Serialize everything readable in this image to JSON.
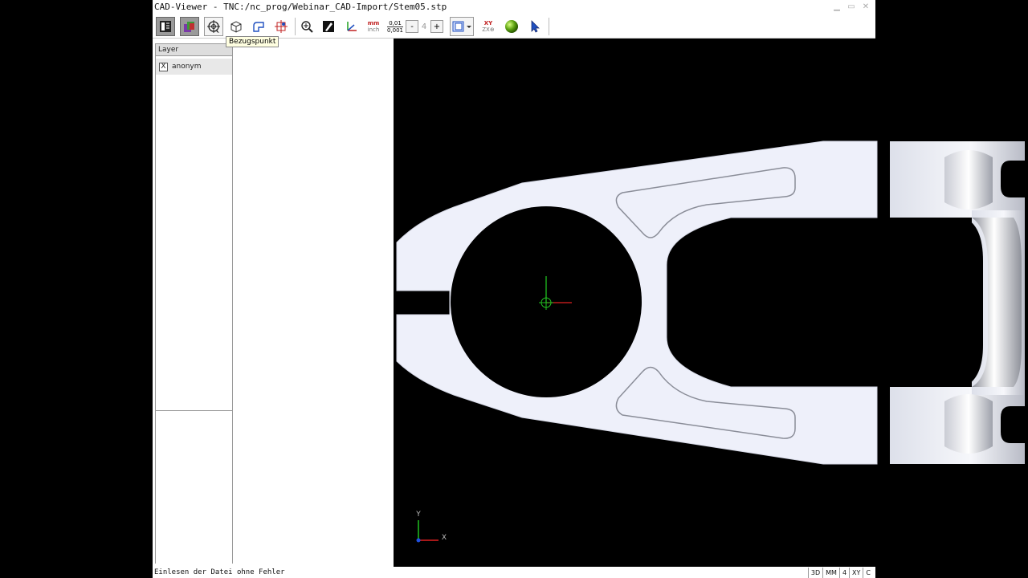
{
  "window": {
    "title": "CAD-Viewer - TNC:/nc_prog/Webinar_CAD-Import/Stem05.stp"
  },
  "toolbar": {
    "units_mm": "mm",
    "units_inch": "inch",
    "resolution_coarse": "0,01",
    "resolution_fine": "0,001",
    "decimals_minus": "-",
    "decimals_value": "4",
    "decimals_plus": "+",
    "plane_top": "XY",
    "plane_bottom": "ZX⊕"
  },
  "tooltip": {
    "text": "Bezugspunkt"
  },
  "layer_panel": {
    "header": "Layer",
    "items": [
      {
        "label": "anonym",
        "checked": "X"
      }
    ]
  },
  "axes": {
    "x": "X",
    "y": "Y"
  },
  "status": {
    "message": "Einlesen der Datei ohne Fehler",
    "cells": [
      "3D",
      "MM",
      "4",
      "XY",
      "C"
    ]
  },
  "colors": {
    "part_face": "#eef0fa",
    "x_axis": "#e02020",
    "y_axis": "#20c020",
    "viewport_bg": "#000000"
  }
}
